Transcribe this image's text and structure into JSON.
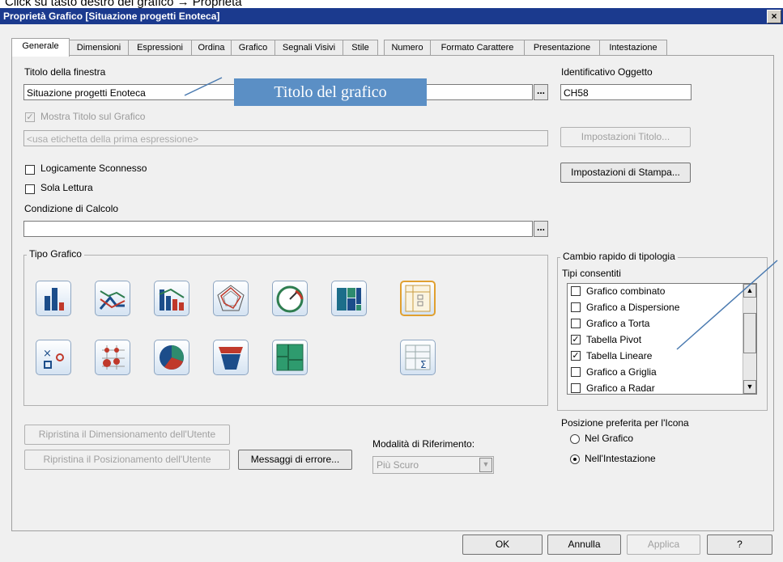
{
  "caption": "Click su tasto destro del grafico → Proprietà",
  "window": {
    "title": "Proprietà Grafico [Situazione progetti Enoteca]",
    "close_label": "×"
  },
  "tabs": [
    {
      "label": "Generale"
    },
    {
      "label": "Dimensioni"
    },
    {
      "label": "Espressioni"
    },
    {
      "label": "Ordina"
    },
    {
      "label": "Grafico"
    },
    {
      "label": "Segnali Visivi"
    },
    {
      "label": "Stile"
    },
    {
      "label": "Numero"
    },
    {
      "label": "Formato Carattere"
    },
    {
      "label": "Presentazione"
    },
    {
      "label": "Intestazione"
    }
  ],
  "general": {
    "window_title_label": "Titolo della finestra",
    "window_title_value": "Situazione progetti Enoteca",
    "dots": "...",
    "object_id_label": "Identificativo Oggetto",
    "object_id_value": "CH58",
    "show_title_label": "Mostra Titolo sul Grafico",
    "show_title_checked": true,
    "title_placeholder": "<usa etichetta della prima espressione>",
    "title_settings_button": "Impostazioni Titolo...",
    "detached_label": "Logicamente Sconnesso",
    "readonly_label": "Sola Lettura",
    "print_settings_button": "Impostazioni di Stampa...",
    "calc_condition_label": "Condizione di Calcolo",
    "calc_condition_value": ""
  },
  "chart_type": {
    "group_title": "Tipo Grafico",
    "icons": [
      "bar-chart-icon",
      "line-chart-icon",
      "combo-chart-icon",
      "radar-chart-icon",
      "gauge-chart-icon",
      "mekko-chart-icon",
      "pivot-table-icon",
      "scatter-chart-icon",
      "grid-chart-icon",
      "pie-chart-icon",
      "funnel-chart-icon",
      "block-chart-icon",
      "straight-table-icon"
    ]
  },
  "quick_change": {
    "group_title": "Cambio rapido di tipologia",
    "allowed_label": "Tipi consentiti",
    "items": [
      {
        "label": "Grafico combinato",
        "checked": false
      },
      {
        "label": "Grafico a Dispersione",
        "checked": false
      },
      {
        "label": "Grafico a Torta",
        "checked": false
      },
      {
        "label": "Tabella Pivot",
        "checked": true
      },
      {
        "label": "Tabella Lineare",
        "checked": true
      },
      {
        "label": "Grafico a Griglia",
        "checked": false
      },
      {
        "label": "Grafico a Radar",
        "checked": false
      }
    ],
    "icon_position_label": "Posizione preferita per l'Icona",
    "radio_in_chart": "Nel Grafico",
    "radio_in_header": "Nell'Intestazione",
    "selected_radio": "Nell'Intestazione"
  },
  "bottom": {
    "reset_size_button": "Ripristina il Dimensionamento dell'Utente",
    "reset_position_button": "Ripristina il Posizionamento dell'Utente",
    "error_messages_button": "Messaggi di errore...",
    "reference_mode_label": "Modalità di Riferimento:",
    "reference_mode_value": "Più Scuro"
  },
  "footer": {
    "ok": "OK",
    "cancel": "Annulla",
    "apply": "Applica",
    "help": "?"
  },
  "callout": {
    "text": "Titolo del grafico",
    "color": "#5b8fc5"
  }
}
